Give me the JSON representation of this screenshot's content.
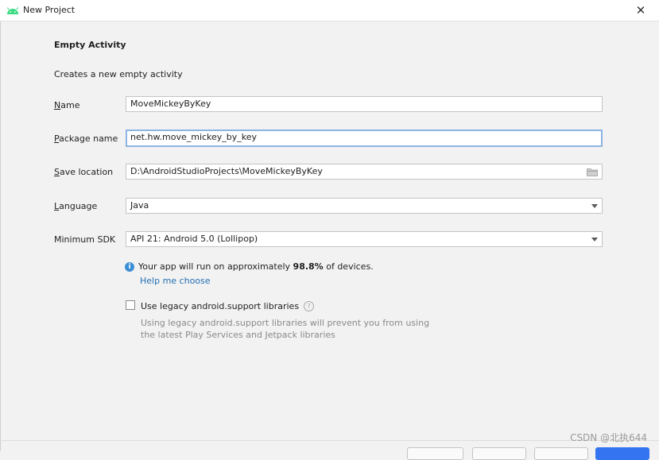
{
  "window": {
    "title": "New Project",
    "icon": "android-icon",
    "close_glyph": "✕"
  },
  "page": {
    "heading": "Empty Activity",
    "subtitle": "Creates a new empty activity"
  },
  "form": {
    "name": {
      "label_mnemonic": "N",
      "label_rest": "ame",
      "value": "MoveMickeyByKey"
    },
    "package": {
      "label_mnemonic": "P",
      "label_rest": "ackage name",
      "value": "net.hw.move_mickey_by_key"
    },
    "location": {
      "label_mnemonic": "S",
      "label_rest": "ave location",
      "value": "D:\\AndroidStudioProjects\\MoveMickeyByKey"
    },
    "language": {
      "label_mnemonic": "L",
      "label_rest": "anguage",
      "value": "Java"
    },
    "min_sdk": {
      "label": "Minimum SDK",
      "value": "API 21: Android 5.0 (Lollipop)"
    }
  },
  "info": {
    "icon_glyph": "i",
    "text_before": "Your app will run on approximately ",
    "percent": "98.8%",
    "text_after": " of devices.",
    "help_link": "Help me choose"
  },
  "legacy": {
    "checked": false,
    "label": "Use legacy android.support libraries",
    "help_glyph": "?",
    "note_line1": "Using legacy android.support libraries will prevent you from using",
    "note_line2": "the latest Play Services and Jetpack libraries"
  },
  "watermark": "CSDN @北执644",
  "colors": {
    "accent": "#3574f0",
    "info_blue": "#3d8fd6",
    "link": "#2470b3",
    "focus_border": "#8cb4e4"
  }
}
